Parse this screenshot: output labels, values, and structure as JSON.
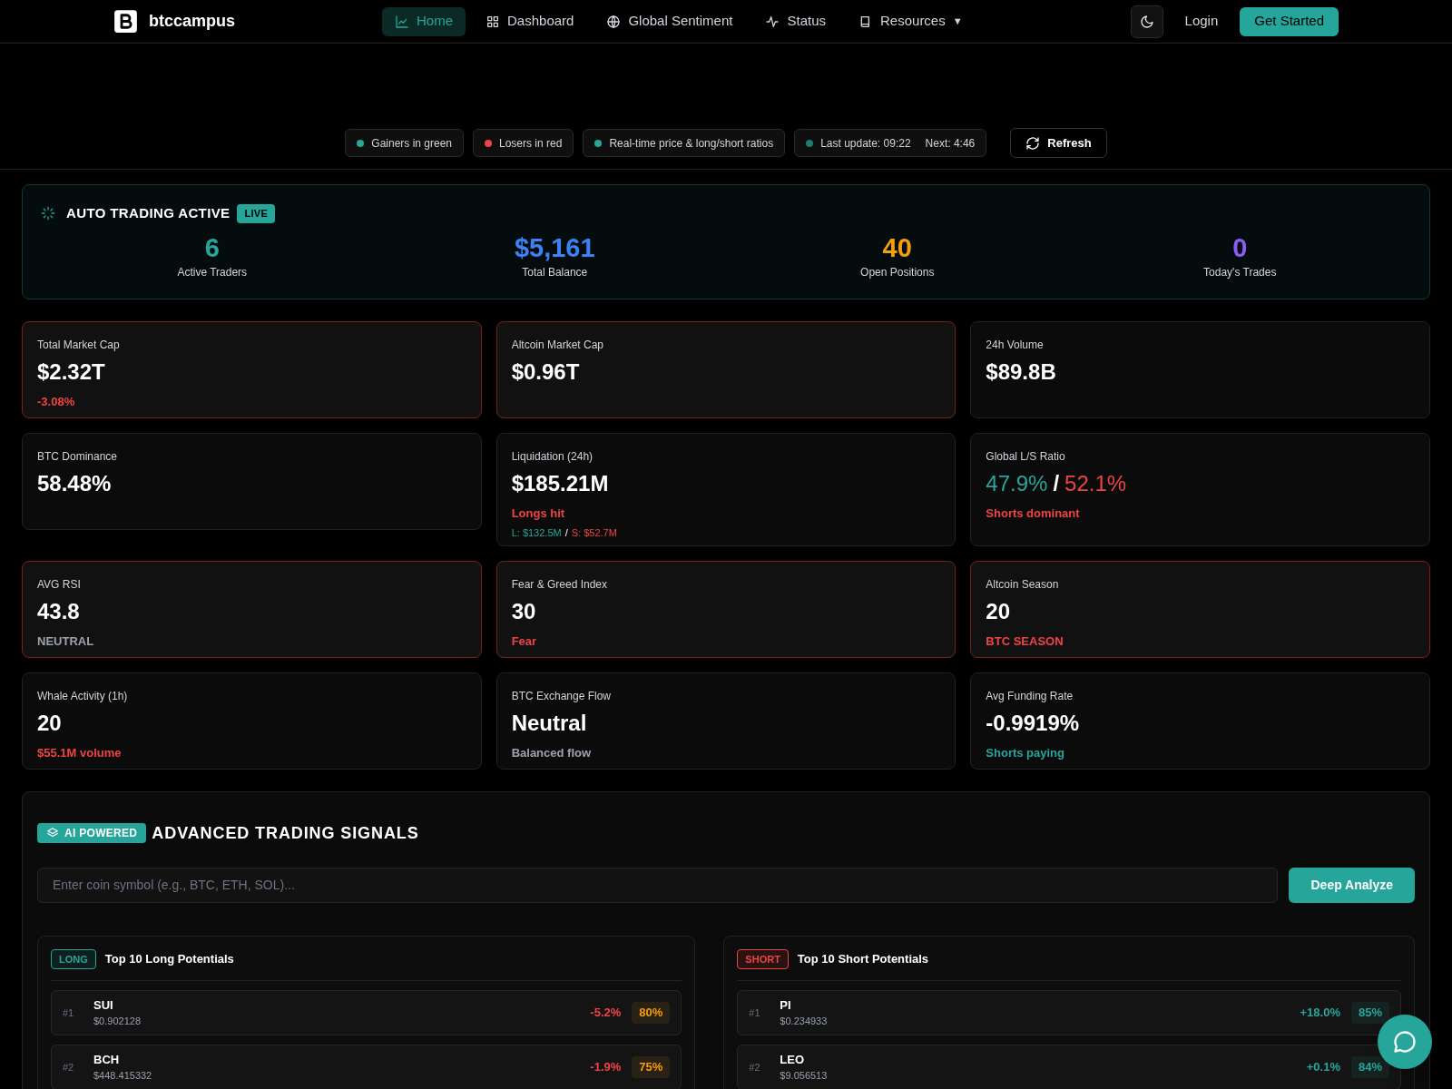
{
  "brand": "btccampus",
  "nav": [
    {
      "label": "Home",
      "selected": true
    },
    {
      "label": "Dashboard",
      "selected": false
    },
    {
      "label": "Global Sentiment",
      "selected": false
    },
    {
      "label": "Status",
      "selected": false
    },
    {
      "label": "Resources",
      "selected": false,
      "caret": "▼"
    }
  ],
  "actions": {
    "login": "Login",
    "cta": "Get Started"
  },
  "legend": [
    {
      "label": "Gainers in green",
      "color": "#26a69a"
    },
    {
      "label": "Losers in red",
      "color": "#ef4444"
    },
    {
      "label": "Real-time price & long/short ratios",
      "color": "#26a69a"
    },
    {
      "label": "Last update: 09:22",
      "extra": "Next: 4:46",
      "color": "#1f7a70"
    }
  ],
  "refresh": "Refresh",
  "auto_trading": {
    "title": "AUTO TRADING ACTIVE",
    "badge": "LIVE",
    "stats": [
      {
        "value": "6",
        "label": "Active Traders",
        "color": "#26a69a"
      },
      {
        "value": "$5,161",
        "label": "Total Balance",
        "color": "#3b82f6"
      },
      {
        "value": "40",
        "label": "Open Positions",
        "color": "#f59e0b"
      },
      {
        "value": "0",
        "label": "Today's Trades",
        "color": "#8b5cf6"
      }
    ]
  },
  "cards": [
    {
      "kind": "plain",
      "label": "Total Market Cap",
      "value": "$2.32T",
      "note": {
        "text": "-3.08%",
        "color": "#ef4444"
      },
      "alert": true
    },
    {
      "kind": "plain",
      "label": "Altcoin Market Cap",
      "value": "$0.96T",
      "alert": true
    },
    {
      "kind": "plain",
      "label": "24h Volume",
      "value": "$89.8B",
      "alert": false
    },
    {
      "kind": "plain",
      "label": "BTC Dominance",
      "value": "58.48%",
      "alert": false
    },
    {
      "kind": "liquidation",
      "label": "Liquidation (24h)",
      "value": "$185.21M",
      "note": {
        "text": "Longs hit",
        "color": "#ef4444"
      },
      "long": "L: $132.5M",
      "sep": "/",
      "short": "S: $52.7M",
      "alert": false
    },
    {
      "kind": "ratio",
      "label": "Global L/S Ratio",
      "long": "47.9%",
      "sep": "/",
      "short": "52.1%",
      "note": {
        "text": "Shorts dominant",
        "color": "#ef4444"
      },
      "alert": false
    },
    {
      "kind": "plain",
      "label": "AVG RSI",
      "value": "43.8",
      "note": {
        "text": "NEUTRAL",
        "color": "#9ca3af"
      },
      "alert": true
    },
    {
      "kind": "plain",
      "label": "Fear & Greed Index",
      "value": "30",
      "note": {
        "text": "Fear",
        "color": "#ef4444"
      },
      "alert": true
    },
    {
      "kind": "plain",
      "label": "Altcoin Season",
      "value": "20",
      "note": {
        "text": "BTC SEASON",
        "color": "#ef4444"
      },
      "alert": true
    },
    {
      "kind": "plain",
      "label": "Whale Activity (1h)",
      "value": "20",
      "note": {
        "text": "$55.1M volume",
        "color": "#ef4444"
      },
      "alert": false
    },
    {
      "kind": "plain",
      "label": "BTC Exchange Flow",
      "value": "Neutral",
      "note": {
        "text": "Balanced flow",
        "color": "#9ca3af"
      },
      "alert": false
    },
    {
      "kind": "plain",
      "label": "Avg Funding Rate",
      "value": "-0.9919%",
      "note": {
        "text": "Shorts paying",
        "color": "#26a69a"
      },
      "alert": false
    }
  ],
  "signals": {
    "badge": "AI POWERED",
    "title": "ADVANCED TRADING SIGNALS",
    "search": {
      "placeholder": "Enter coin symbol (e.g., BTC, ETH, SOL)..."
    },
    "button": "Deep Analyze",
    "lists": [
      {
        "tag": {
          "text": "LONG",
          "color": "#26a69a"
        },
        "title": "Top 10 Long Potentials",
        "rows": [
          {
            "rank": "#1",
            "symbol": "SUI",
            "price": "$0.902128",
            "change": {
              "text": "-5.2%",
              "color": "#ef4444"
            },
            "confidence": {
              "text": "80%",
              "color": "#f59e0b"
            }
          },
          {
            "rank": "#2",
            "symbol": "BCH",
            "price": "$448.415332",
            "change": {
              "text": "-1.9%",
              "color": "#ef4444"
            },
            "confidence": {
              "text": "75%",
              "color": "#f59e0b"
            }
          }
        ]
      },
      {
        "tag": {
          "text": "SHORT",
          "color": "#ef4444"
        },
        "title": "Top 10 Short Potentials",
        "rows": [
          {
            "rank": "#1",
            "symbol": "PI",
            "price": "$0.234933",
            "change": {
              "text": "+18.0%",
              "color": "#26a69a"
            },
            "confidence": {
              "text": "85%",
              "color": "#26a69a"
            }
          },
          {
            "rank": "#2",
            "symbol": "LEO",
            "price": "$9.056513",
            "change": {
              "text": "+0.1%",
              "color": "#26a69a"
            },
            "confidence": {
              "text": "84%",
              "color": "#26a69a"
            }
          }
        ]
      }
    ]
  }
}
